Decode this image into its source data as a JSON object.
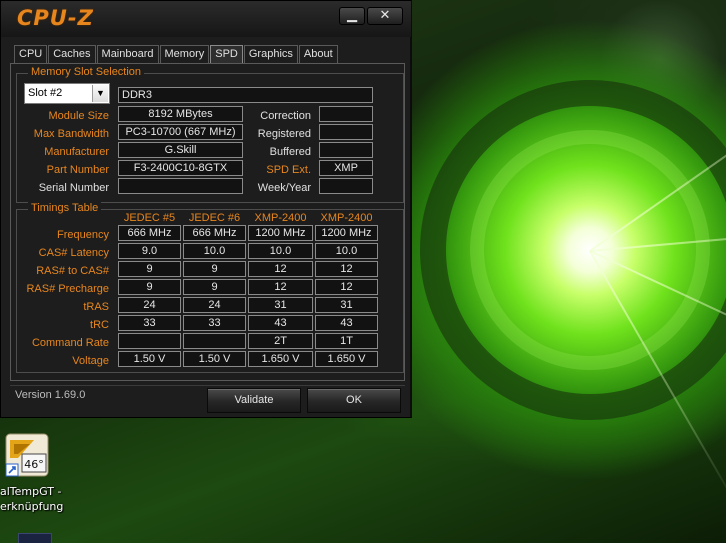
{
  "window": {
    "title": "CPU-Z",
    "min_label": "▁",
    "close_label": "✕"
  },
  "tabs": [
    {
      "label": "CPU",
      "active": false
    },
    {
      "label": "Caches",
      "active": false
    },
    {
      "label": "Mainboard",
      "active": false
    },
    {
      "label": "Memory",
      "active": false
    },
    {
      "label": "SPD",
      "active": true
    },
    {
      "label": "Graphics",
      "active": false
    },
    {
      "label": "About",
      "active": false
    }
  ],
  "memory_slot": {
    "group_title": "Memory Slot Selection",
    "slot_selected": "Slot #2",
    "type": "DDR3",
    "labels": {
      "module_size": "Module Size",
      "max_bandwidth": "Max Bandwidth",
      "manufacturer": "Manufacturer",
      "part_number": "Part Number",
      "serial_number": "Serial Number",
      "correction": "Correction",
      "registered": "Registered",
      "buffered": "Buffered",
      "spd_ext": "SPD Ext.",
      "week_year": "Week/Year"
    },
    "values": {
      "module_size": "8192 MBytes",
      "max_bandwidth": "PC3-10700 (667 MHz)",
      "manufacturer": "G.Skill",
      "part_number": "F3-2400C10-8GTX",
      "serial_number": "",
      "correction": "",
      "registered": "",
      "buffered": "",
      "spd_ext": "XMP",
      "week_year": ""
    }
  },
  "timings": {
    "group_title": "Timings Table",
    "columns": [
      "JEDEC #5",
      "JEDEC #6",
      "XMP-2400",
      "XMP-2400"
    ],
    "rows": [
      {
        "label": "Frequency",
        "values": [
          "666 MHz",
          "666 MHz",
          "1200 MHz",
          "1200 MHz"
        ]
      },
      {
        "label": "CAS# Latency",
        "values": [
          "9.0",
          "10.0",
          "10.0",
          "10.0"
        ]
      },
      {
        "label": "RAS# to CAS#",
        "values": [
          "9",
          "9",
          "12",
          "12"
        ]
      },
      {
        "label": "RAS# Precharge",
        "values": [
          "9",
          "9",
          "12",
          "12"
        ]
      },
      {
        "label": "tRAS",
        "values": [
          "24",
          "24",
          "31",
          "31"
        ]
      },
      {
        "label": "tRC",
        "values": [
          "33",
          "33",
          "43",
          "43"
        ]
      },
      {
        "label": "Command Rate",
        "values": [
          "",
          "",
          "2T",
          "1T"
        ]
      },
      {
        "label": "Voltage",
        "values": [
          "1.50 V",
          "1.50 V",
          "1.650 V",
          "1.650 V"
        ]
      }
    ]
  },
  "footer": {
    "version": "Version 1.69.0",
    "validate_label": "Validate",
    "ok_label": "OK"
  },
  "desktop_icon": {
    "line1": "alTempGT -",
    "line2": "erknüpfung",
    "badge": "46°"
  },
  "colors": {
    "accent_orange": "#e8861e",
    "window_bg": "#1d1d1d"
  }
}
